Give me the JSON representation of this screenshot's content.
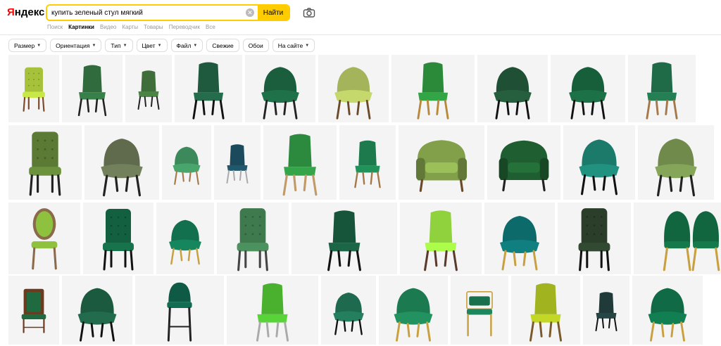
{
  "logo": {
    "y": "Я",
    "rest": "ндекс"
  },
  "search": {
    "query": "купить зеленый стул мягкий",
    "button": "Найти"
  },
  "services": [
    {
      "label": "Поиск",
      "active": false
    },
    {
      "label": "Картинки",
      "active": true
    },
    {
      "label": "Видео",
      "active": false
    },
    {
      "label": "Карты",
      "active": false
    },
    {
      "label": "Товары",
      "active": false
    },
    {
      "label": "Переводчик",
      "active": false
    },
    {
      "label": "Все",
      "active": false
    }
  ],
  "filters": [
    {
      "label": "Размер",
      "dropdown": true
    },
    {
      "label": "Ориентация",
      "dropdown": true
    },
    {
      "label": "Тип",
      "dropdown": true
    },
    {
      "label": "Цвет",
      "dropdown": true
    },
    {
      "label": "Файл",
      "dropdown": true
    },
    {
      "label": "Свежие",
      "dropdown": false
    },
    {
      "label": "Обои",
      "dropdown": false
    },
    {
      "label": "На сайте",
      "dropdown": true
    }
  ],
  "icons": {
    "clear": "clear-icon",
    "camera": "camera-search-icon",
    "dropdown": "chevron-down-icon"
  },
  "colors": {
    "accent": "#ffcc00",
    "logo_red": "#ff0000"
  },
  "gallery": [
    {
      "tiles": [
        {
          "kind": "tufted",
          "color": "#a6c13a",
          "legs": "#7a4a2a"
        },
        {
          "kind": "chair",
          "color": "#2f6b3d",
          "legs": "#222"
        },
        {
          "kind": "chair",
          "color": "#3f6e3a",
          "legs": "#222"
        },
        {
          "kind": "chair",
          "color": "#1f5a3f",
          "legs": "#111"
        },
        {
          "kind": "arm",
          "color": "#1a5e3e",
          "legs": "#222"
        },
        {
          "kind": "arm",
          "color": "#a4b45a",
          "legs": "#6b4a2a"
        },
        {
          "kind": "chair",
          "color": "#2a8a3a",
          "legs": "#b8893a"
        },
        {
          "kind": "arm",
          "color": "#1f4f34",
          "legs": "#111"
        },
        {
          "kind": "arm",
          "color": "#175e3a",
          "legs": "#111"
        },
        {
          "kind": "chair",
          "color": "#1f6a47",
          "legs": "#a5784a"
        }
      ]
    },
    {
      "tiles": [
        {
          "kind": "tufted",
          "color": "#5b7a34",
          "legs": "#222"
        },
        {
          "kind": "arm",
          "color": "#5f6b4c",
          "legs": "#222"
        },
        {
          "kind": "arm",
          "color": "#3c8a5b",
          "legs": "#a5784a"
        },
        {
          "kind": "chair",
          "color": "#1b4a5c",
          "legs": "#aaa"
        },
        {
          "kind": "chair",
          "color": "#2b8a3d",
          "legs": "#c29a68"
        },
        {
          "kind": "chair",
          "color": "#1c7a4c",
          "legs": "#a5784a"
        },
        {
          "kind": "club",
          "color": "#82a04a",
          "legs": "#6b4a2a"
        },
        {
          "kind": "club",
          "color": "#1f5e30",
          "legs": "#222"
        },
        {
          "kind": "arm",
          "color": "#1c7a6b",
          "legs": "#111"
        },
        {
          "kind": "arm",
          "color": "#6f8a4a",
          "legs": "#222"
        }
      ]
    },
    {
      "tiles": [
        {
          "kind": "oval",
          "color": "#8ec23e",
          "legs": "#8a6a4a"
        },
        {
          "kind": "tufted",
          "color": "#12603f",
          "legs": "#111"
        },
        {
          "kind": "arm",
          "color": "#12704f",
          "legs": "#c8a040"
        },
        {
          "kind": "tufted",
          "color": "#3f7a4f",
          "legs": "#444"
        },
        {
          "kind": "chair",
          "color": "#16553a",
          "legs": "#111"
        },
        {
          "kind": "chair",
          "color": "#8fd23e",
          "legs": "#5a3a2a"
        },
        {
          "kind": "arm",
          "color": "#0d6a6a",
          "legs": "#c8a040"
        },
        {
          "kind": "tufted",
          "color": "#2a3e2a",
          "legs": "#111"
        },
        {
          "kind": "shell",
          "color": "#11663f",
          "legs": "#c8a040"
        }
      ]
    },
    {
      "tiles": [
        {
          "kind": "classic",
          "color": "#1f6a3f",
          "legs": "#6b3a1f"
        },
        {
          "kind": "arm",
          "color": "#1c5a40",
          "legs": "#111"
        },
        {
          "kind": "bar",
          "color": "#0f5a44",
          "legs": "#222"
        },
        {
          "kind": "chair",
          "color": "#4ab12f",
          "legs": "#aaa"
        },
        {
          "kind": "arm",
          "color": "#1e6a4f",
          "legs": "#111"
        },
        {
          "kind": "arm",
          "color": "#1c7a50",
          "legs": "#c8a040"
        },
        {
          "kind": "wire",
          "color": "#19704d",
          "legs": "#c8a040"
        },
        {
          "kind": "chair",
          "color": "#a2b320",
          "legs": "#7a5a2a"
        },
        {
          "kind": "chair",
          "color": "#203a3a",
          "legs": "#111"
        },
        {
          "kind": "arm",
          "color": "#0f6a45",
          "legs": "#c8a040"
        }
      ]
    }
  ]
}
